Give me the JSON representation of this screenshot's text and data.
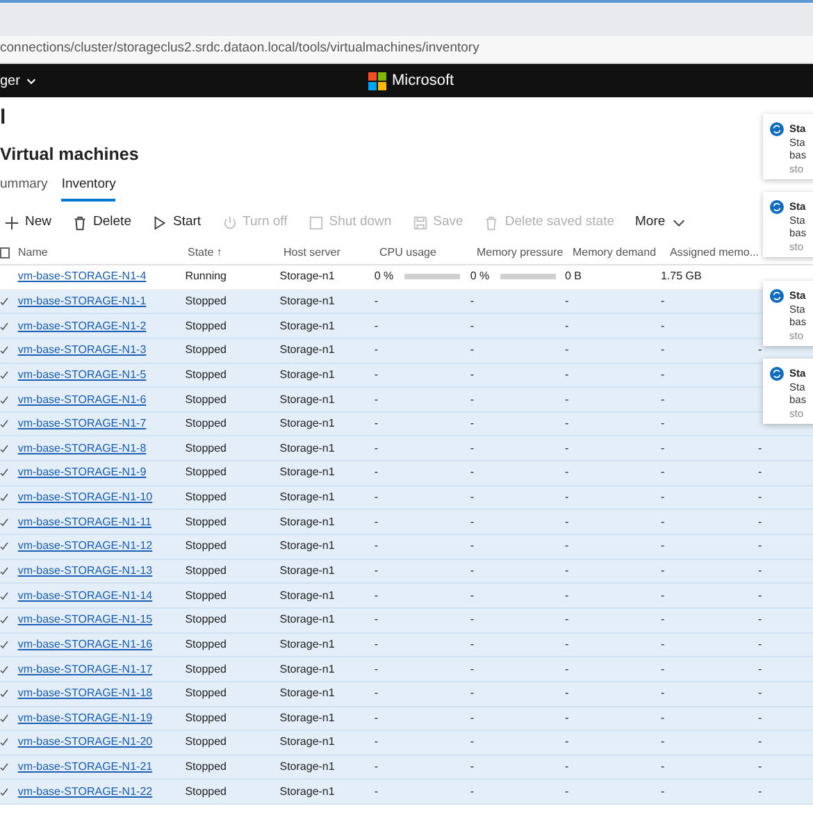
{
  "address_bar": {
    "url": "connections/cluster/storageclus2.srdc.dataon.local/tools/virtualmachines/inventory"
  },
  "header": {
    "menu_label": "ger",
    "brand": "Microsoft"
  },
  "page": {
    "title": "l",
    "subtitle": "Virtual machines"
  },
  "tabs": [
    {
      "label": "ummary",
      "selected": false
    },
    {
      "label": "Inventory",
      "selected": true
    }
  ],
  "toolbar": [
    {
      "label": "New",
      "kind": "plus",
      "disabled": false
    },
    {
      "label": "Delete",
      "kind": "trash",
      "disabled": false
    },
    {
      "label": "Start",
      "kind": "play",
      "disabled": false
    },
    {
      "label": "Turn off",
      "kind": "power",
      "disabled": true
    },
    {
      "label": "Shut down",
      "kind": "square",
      "disabled": true
    },
    {
      "label": "Save",
      "kind": "save",
      "disabled": true
    },
    {
      "label": "Delete saved state",
      "kind": "trash",
      "disabled": true
    },
    {
      "label": "More",
      "kind": "chevron",
      "disabled": false
    }
  ],
  "table": {
    "select_all": {
      "checked": false
    },
    "columns": [
      "Name",
      "State ↑",
      "Host server",
      "CPU usage",
      "Memory pressure",
      "Memory demand",
      "Assigned memo..."
    ],
    "rows": [
      {
        "name": "vm-base-STORAGE-N1-4",
        "state": "Running",
        "host": "Storage-n1",
        "cpu": "0 %",
        "cpu_meter": {
          "level": 0
        },
        "pressure": "0 %",
        "pressure_meter": {
          "level": 0
        },
        "demand": "0 B",
        "assigned": "1.75 GB",
        "selected": false
      },
      {
        "name": "vm-base-STORAGE-N1-1",
        "state": "Stopped",
        "host": "Storage-n1",
        "cpu": "-",
        "pressure": "-",
        "demand": "-",
        "assigned": "-",
        "selected": true
      },
      {
        "name": "vm-base-STORAGE-N1-2",
        "state": "Stopped",
        "host": "Storage-n1",
        "cpu": "-",
        "pressure": "-",
        "demand": "-",
        "assigned": "-",
        "selected": true
      },
      {
        "name": "vm-base-STORAGE-N1-3",
        "state": "Stopped",
        "host": "Storage-n1",
        "cpu": "-",
        "pressure": "-",
        "demand": "-",
        "assigned": "-",
        "column_9": "-",
        "selected": true
      },
      {
        "name": "vm-base-STORAGE-N1-5",
        "state": "Stopped",
        "host": "Storage-n1",
        "cpu": "-",
        "pressure": "-",
        "demand": "-",
        "assigned": "-",
        "selected": true
      },
      {
        "name": "vm-base-STORAGE-N1-6",
        "state": "Stopped",
        "host": "Storage-n1",
        "cpu": "-",
        "pressure": "-",
        "demand": "-",
        "assigned": "-",
        "selected": true
      },
      {
        "name": "vm-base-STORAGE-N1-7",
        "state": "Stopped",
        "host": "Storage-n1",
        "cpu": "-",
        "pressure": "-",
        "demand": "-",
        "assigned": "-",
        "selected": true
      },
      {
        "name": "vm-base-STORAGE-N1-8",
        "state": "Stopped",
        "host": "Storage-n1",
        "cpu": "-",
        "pressure": "-",
        "demand": "-",
        "assigned": "-",
        "column_9": "-",
        "selected": true
      },
      {
        "name": "vm-base-STORAGE-N1-9",
        "state": "Stopped",
        "host": "Storage-n1",
        "cpu": "-",
        "pressure": "-",
        "demand": "-",
        "assigned": "-",
        "column_9": "-",
        "selected": true
      },
      {
        "name": "vm-base-STORAGE-N1-10",
        "state": "Stopped",
        "host": "Storage-n1",
        "cpu": "-",
        "pressure": "-",
        "demand": "-",
        "assigned": "-",
        "column_9": "-",
        "selected": true
      },
      {
        "name": "vm-base-STORAGE-N1-11",
        "state": "Stopped",
        "host": "Storage-n1",
        "cpu": "-",
        "pressure": "-",
        "demand": "-",
        "assigned": "-",
        "column_9": "-",
        "selected": true
      },
      {
        "name": "vm-base-STORAGE-N1-12",
        "state": "Stopped",
        "host": "Storage-n1",
        "cpu": "-",
        "pressure": "-",
        "demand": "-",
        "assigned": "-",
        "column_9": "-",
        "selected": true
      },
      {
        "name": "vm-base-STORAGE-N1-13",
        "state": "Stopped",
        "host": "Storage-n1",
        "cpu": "-",
        "pressure": "-",
        "demand": "-",
        "assigned": "-",
        "column_9": "-",
        "selected": true
      },
      {
        "name": "vm-base-STORAGE-N1-14",
        "state": "Stopped",
        "host": "Storage-n1",
        "cpu": "-",
        "pressure": "-",
        "demand": "-",
        "assigned": "-",
        "column_9": "-",
        "selected": true
      },
      {
        "name": "vm-base-STORAGE-N1-15",
        "state": "Stopped",
        "host": "Storage-n1",
        "cpu": "-",
        "pressure": "-",
        "demand": "-",
        "assigned": "-",
        "column_9": "-",
        "selected": true
      },
      {
        "name": "vm-base-STORAGE-N1-16",
        "state": "Stopped",
        "host": "Storage-n1",
        "cpu": "-",
        "pressure": "-",
        "demand": "-",
        "assigned": "-",
        "column_9": "-",
        "selected": true
      },
      {
        "name": "vm-base-STORAGE-N1-17",
        "state": "Stopped",
        "host": "Storage-n1",
        "cpu": "-",
        "pressure": "-",
        "demand": "-",
        "assigned": "-",
        "column_9": "-",
        "selected": true
      },
      {
        "name": "vm-base-STORAGE-N1-18",
        "state": "Stopped",
        "host": "Storage-n1",
        "cpu": "-",
        "pressure": "-",
        "demand": "-",
        "assigned": "-",
        "column_9": "-",
        "selected": true
      },
      {
        "name": "vm-base-STORAGE-N1-19",
        "state": "Stopped",
        "host": "Storage-n1",
        "cpu": "-",
        "pressure": "-",
        "demand": "-",
        "assigned": "-",
        "column_9": "-",
        "selected": true
      },
      {
        "name": "vm-base-STORAGE-N1-20",
        "state": "Stopped",
        "host": "Storage-n1",
        "cpu": "-",
        "pressure": "-",
        "demand": "-",
        "assigned": "-",
        "column_9": "-",
        "selected": true
      },
      {
        "name": "vm-base-STORAGE-N1-21",
        "state": "Stopped",
        "host": "Storage-n1",
        "cpu": "-",
        "pressure": "-",
        "demand": "-",
        "assigned": "-",
        "column_9": "-",
        "selected": true
      },
      {
        "name": "vm-base-STORAGE-N1-22",
        "state": "Stopped",
        "host": "Storage-n1",
        "cpu": "-",
        "pressure": "-",
        "demand": "-",
        "assigned": "-",
        "column_9": "-",
        "selected": true
      }
    ]
  },
  "notifications": [
    {
      "title": "Sta",
      "lines": [
        "Sta",
        "bas",
        "sto"
      ]
    },
    {
      "title": "Sta",
      "lines": [
        "Sta",
        "bas",
        "sto"
      ]
    },
    {
      "title": "Sta",
      "lines": [
        "Sta",
        "bas",
        "sto"
      ]
    },
    {
      "title": "Sta",
      "lines": [
        "Sta",
        "bas",
        "sto"
      ]
    }
  ]
}
